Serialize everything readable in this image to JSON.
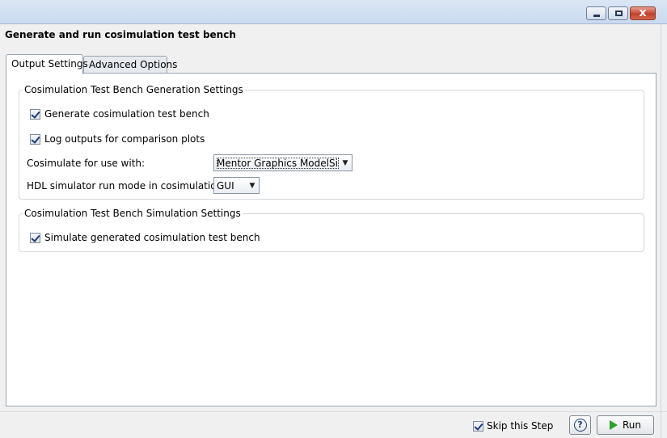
{
  "window": {
    "minimize_icon": "minimize-icon",
    "maximize_icon": "maximize-icon",
    "close_glyph": "x"
  },
  "header": {
    "title": "Generate and run cosimulation test bench"
  },
  "tabs": [
    {
      "label": "Output Settings",
      "active": true
    },
    {
      "label": "Advanced Options",
      "active": false
    }
  ],
  "generation_group": {
    "legend": "Cosimulation Test Bench Generation Settings",
    "generate_tb": {
      "label": "Generate cosimulation test bench",
      "checked": true
    },
    "log_outputs": {
      "label": "Log outputs for comparison plots",
      "checked": true
    },
    "cosim_for": {
      "label": "Cosimulate for use with:",
      "value": "Mentor Graphics ModelSim"
    },
    "run_mode": {
      "label": "HDL simulator run mode in cosimulation:",
      "value": "GUI"
    }
  },
  "simulation_group": {
    "legend": "Cosimulation Test Bench Simulation Settings",
    "simulate_tb": {
      "label": "Simulate generated cosimulation test bench",
      "checked": true
    }
  },
  "footer": {
    "skip_step": {
      "label": "Skip this Step",
      "checked": true
    },
    "help_glyph": "?",
    "run_label": "Run"
  },
  "colors": {
    "accent": "#1f3a7a",
    "run_icon": "#2aa12a"
  }
}
